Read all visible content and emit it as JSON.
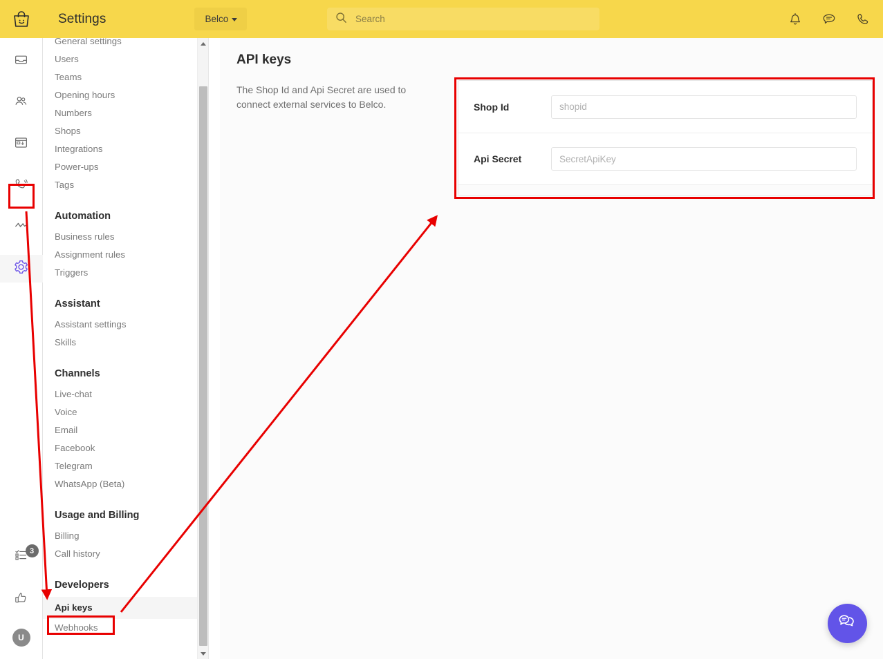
{
  "header": {
    "logo_icon": "shopping-bag-smile-logo",
    "title": "Settings",
    "org_button": "Belco",
    "search_placeholder": "Search",
    "search_value": "",
    "search_icon": "search-icon",
    "icons": [
      {
        "name": "bell-icon",
        "label": "Notifications"
      },
      {
        "name": "chat-bubble-icon",
        "label": "Messages"
      },
      {
        "name": "phone-icon",
        "label": "Calls"
      }
    ],
    "brand_color": "#F7D74B"
  },
  "rail": {
    "top_items": [
      {
        "name": "inbox-icon",
        "label": "Inbox",
        "active": false
      },
      {
        "name": "contacts-icon",
        "label": "Contacts",
        "active": false
      },
      {
        "name": "browser-window-icon",
        "label": "Campaigns",
        "active": false
      },
      {
        "name": "phone-ring-icon",
        "label": "Voice",
        "active": false
      },
      {
        "name": "analytics-icon",
        "label": "Reports",
        "active": false
      },
      {
        "name": "gear-icon",
        "label": "Settings",
        "active": true
      }
    ],
    "bottom_items": [
      {
        "name": "checklist-icon",
        "label": "Tasks",
        "badge": "3"
      },
      {
        "name": "thumbs-up-icon",
        "label": "Feedback",
        "badge": ""
      }
    ],
    "avatar_initial": "U"
  },
  "nav": {
    "items": [
      {
        "type": "link",
        "label": "General settings",
        "selected": false
      },
      {
        "type": "link",
        "label": "Users",
        "selected": false
      },
      {
        "type": "link",
        "label": "Teams",
        "selected": false
      },
      {
        "type": "link",
        "label": "Opening hours",
        "selected": false
      },
      {
        "type": "link",
        "label": "Numbers",
        "selected": false
      },
      {
        "type": "link",
        "label": "Shops",
        "selected": false
      },
      {
        "type": "link",
        "label": "Integrations",
        "selected": false
      },
      {
        "type": "link",
        "label": "Power-ups",
        "selected": false
      },
      {
        "type": "link",
        "label": "Tags",
        "selected": false
      },
      {
        "type": "group",
        "label": "Automation",
        "selected": false
      },
      {
        "type": "link",
        "label": "Business rules",
        "selected": false
      },
      {
        "type": "link",
        "label": "Assignment rules",
        "selected": false
      },
      {
        "type": "link",
        "label": "Triggers",
        "selected": false
      },
      {
        "type": "group",
        "label": "Assistant",
        "selected": false
      },
      {
        "type": "link",
        "label": "Assistant settings",
        "selected": false
      },
      {
        "type": "link",
        "label": "Skills",
        "selected": false
      },
      {
        "type": "group",
        "label": "Channels",
        "selected": false
      },
      {
        "type": "link",
        "label": "Live-chat",
        "selected": false
      },
      {
        "type": "link",
        "label": "Voice",
        "selected": false
      },
      {
        "type": "link",
        "label": "Email",
        "selected": false
      },
      {
        "type": "link",
        "label": "Facebook",
        "selected": false
      },
      {
        "type": "link",
        "label": "Telegram",
        "selected": false
      },
      {
        "type": "link",
        "label": "WhatsApp (Beta)",
        "selected": false
      },
      {
        "type": "group",
        "label": "Usage and Billing",
        "selected": false
      },
      {
        "type": "link",
        "label": "Billing",
        "selected": false
      },
      {
        "type": "link",
        "label": "Call history",
        "selected": false
      },
      {
        "type": "group",
        "label": "Developers",
        "selected": false
      },
      {
        "type": "link",
        "label": "Api keys",
        "selected": true
      },
      {
        "type": "link",
        "label": "Webhooks",
        "selected": false
      }
    ]
  },
  "main": {
    "title": "API keys",
    "description": "The Shop Id and Api Secret are used to connect external services to Belco.",
    "fields": [
      {
        "label": "Shop Id",
        "placeholder": "shopid",
        "value": ""
      },
      {
        "label": "Api Secret",
        "placeholder": "SecretApiKey",
        "value": ""
      }
    ]
  },
  "chat_widget": {
    "icon": "chat-bubbles-icon",
    "color": "#6254E8"
  },
  "annotations": {
    "color": "#e80000",
    "boxes": [
      {
        "name": "gear-icon-highlight"
      },
      {
        "name": "api-keys-item-highlight"
      },
      {
        "name": "api-keys-form-highlight"
      }
    ],
    "arrows": [
      {
        "name": "arrow-to-developers-section"
      },
      {
        "name": "arrow-to-api-keys-form"
      }
    ]
  }
}
